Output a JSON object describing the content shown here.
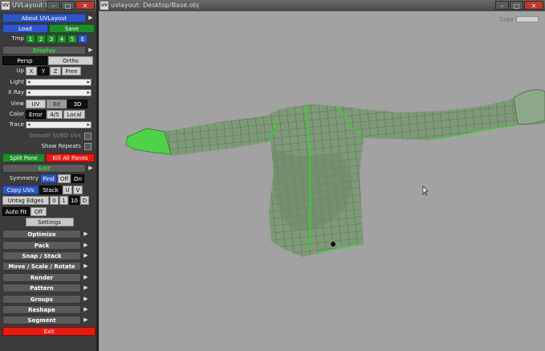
{
  "panel_window": {
    "title": "UVLayout 8..."
  },
  "viewport_window": {
    "title": "uvlayout: Desktop/Base.obj",
    "copy_label": "Copy"
  },
  "window_controls": {
    "minimize": "–",
    "maximize": "□",
    "close": "✕"
  },
  "app_icon_text": "UV",
  "panel": {
    "about": "About UVLayout",
    "load": "Load",
    "save": "Save",
    "tmp_label": "Tmp",
    "tmp_slots": [
      "1",
      "2",
      "3",
      "4",
      "5",
      "E"
    ],
    "display_header": "Display",
    "persp": "Persp",
    "ortho": "Ortho",
    "up_label": "Up",
    "up_options": [
      "X",
      "Y",
      "Z",
      "Free"
    ],
    "light_label": "Light",
    "xray_label": "X Ray",
    "view_label": "View",
    "view_options": [
      "UV",
      "Ed",
      "3D"
    ],
    "color_label": "Color",
    "color_options": [
      "Error",
      "4/5",
      "Local"
    ],
    "trace_label": "Trace",
    "smooth_subd": "Smooth SUBD UVs",
    "show_repeats": "Show Repeats",
    "split_pane": "Split Pane",
    "kill_panes": "Kill All Panes",
    "edit_header": "Edit",
    "symmetry_label": "Symmetry",
    "find": "Find",
    "off": "Off",
    "on": "On",
    "copy_uvs": "Copy UVs",
    "stack": "Stack",
    "u": "U",
    "v": "V",
    "untag_edges": "Untag Edges",
    "edge_values": [
      "0",
      "1",
      "10",
      "D"
    ],
    "auto_fit": "Auto Fit",
    "auto_fit_value": "Off",
    "settings": "Settings",
    "sections": [
      "Optimize",
      "Pack",
      "Snap / Stack",
      "Move / Scale / Rotate",
      "Render",
      "Pattern",
      "Groups",
      "Reshape",
      "Segment"
    ],
    "exit": "Exit",
    "arrow_glyph": "▶"
  },
  "colors": {
    "accent_blue": "#2f56c9",
    "accent_green": "#1f8c2a",
    "accent_red": "#e31c13",
    "viewport_bg": "#a2a2a2",
    "mesh_fill": "#7e9a78",
    "mesh_wire": "#3d4a3a",
    "seam": "#27e022"
  }
}
